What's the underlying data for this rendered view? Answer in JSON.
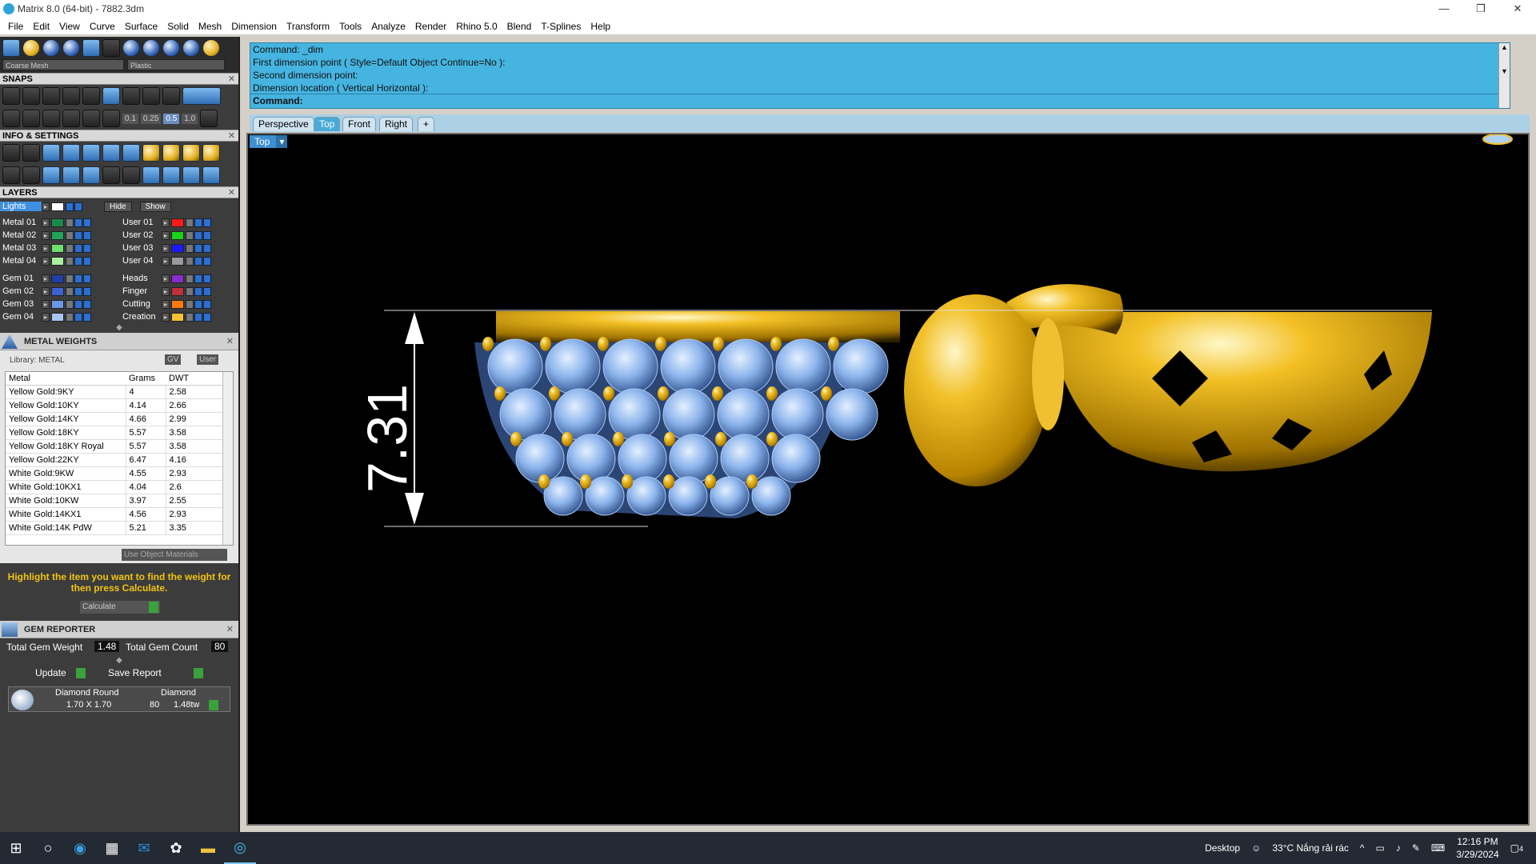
{
  "window": {
    "title": "Matrix 8.0 (64-bit) - 7882.3dm",
    "minimize": "—",
    "maximize": "❐",
    "close": "✕"
  },
  "menu": [
    "File",
    "Edit",
    "View",
    "Curve",
    "Surface",
    "Solid",
    "Mesh",
    "Dimension",
    "Transform",
    "Tools",
    "Analyze",
    "Render",
    "Rhino 5.0",
    "Blend",
    "T-Splines",
    "Help"
  ],
  "toolbar": {
    "mesh_combo": "Coarse Mesh",
    "material_combo": "Plastic"
  },
  "snaps": {
    "title": "SNAPS",
    "values": [
      "0.1",
      "0.25",
      "0.5",
      "1.0"
    ]
  },
  "info": {
    "title": "INFO & SETTINGS"
  },
  "layers": {
    "title": "LAYERS",
    "hide_label": "Hide",
    "show_label": "Show",
    "selected": "Lights",
    "left": [
      {
        "name": "Metal 01",
        "color": "#1a8a4a"
      },
      {
        "name": "Metal 02",
        "color": "#22a35a"
      },
      {
        "name": "Metal 03",
        "color": "#6ee06e"
      },
      {
        "name": "Metal 04",
        "color": "#a8f0a0"
      },
      {
        "name": "Gem 01",
        "color": "#1e3fa8"
      },
      {
        "name": "Gem 02",
        "color": "#3a63d0"
      },
      {
        "name": "Gem 03",
        "color": "#6a98e8"
      },
      {
        "name": "Gem 04",
        "color": "#a9c6f2"
      }
    ],
    "right": [
      {
        "name": "User 01",
        "color": "#ff1a1a"
      },
      {
        "name": "User 02",
        "color": "#19d219"
      },
      {
        "name": "User 03",
        "color": "#1a1aff"
      },
      {
        "name": "User 04",
        "color": "#9a9a9a"
      },
      {
        "name": "Heads",
        "color": "#8a2bd0"
      },
      {
        "name": "Finger",
        "color": "#c0303a"
      },
      {
        "name": "Cutting",
        "color": "#ff7a10"
      },
      {
        "name": "Creation",
        "color": "#f6c234"
      }
    ]
  },
  "metal_weights": {
    "title": "METAL WEIGHTS",
    "library_label": "Library: METAL",
    "gv_label": "GV",
    "user_label": "User",
    "columns": [
      "Metal",
      "Grams",
      "DWT"
    ],
    "rows": [
      [
        "Yellow Gold:9KY",
        "4",
        "2.58"
      ],
      [
        "Yellow Gold:10KY",
        "4.14",
        "2.66"
      ],
      [
        "Yellow Gold:14KY",
        "4.66",
        "2.99"
      ],
      [
        "Yellow Gold:18KY",
        "5.57",
        "3.58"
      ],
      [
        "Yellow Gold:18KY Royal",
        "5.57",
        "3.58"
      ],
      [
        "Yellow Gold:22KY",
        "6.47",
        "4.16"
      ],
      [
        "White Gold:9KW",
        "4.55",
        "2.93"
      ],
      [
        "White Gold:10KX1",
        "4.04",
        "2.6"
      ],
      [
        "White Gold:10KW",
        "3.97",
        "2.55"
      ],
      [
        "White Gold:14KX1",
        "4.56",
        "2.93"
      ],
      [
        "White Gold:14K PdW",
        "5.21",
        "3.35"
      ]
    ],
    "use_object_materials": "Use Object Materials",
    "hint": "Highlight the item you want to find the weight for then press Calculate.",
    "calculate": "Calculate"
  },
  "gem_reporter": {
    "title": "GEM REPORTER",
    "total_weight_label": "Total Gem Weight",
    "total_weight": "1.48",
    "total_count_label": "Total Gem Count",
    "total_count": "80",
    "update": "Update",
    "save_report": "Save Report",
    "item": {
      "shape": "Diamond Round",
      "material": "Diamond",
      "size": "1.70 X 1.70",
      "count": "80",
      "weight": "1.48tw"
    }
  },
  "command": {
    "lines": [
      "Command: _dim",
      "First dimension point ( Style=Default  Object  Continue=No ):",
      "Second dimension point:",
      "Dimension location ( Vertical  Horizontal ):"
    ],
    "prompt": "Command:"
  },
  "viewport_tabs": [
    "Perspective",
    "Top",
    "Front",
    "Right",
    "+"
  ],
  "active_tab": "Top",
  "viewport": {
    "label": "Top",
    "dimension": "7.31"
  },
  "taskbar": {
    "desktop": "Desktop",
    "weather": "33°C  Nắng rải rác",
    "time": "12:16 PM",
    "date": "3/29/2024",
    "notification_count": "4"
  }
}
